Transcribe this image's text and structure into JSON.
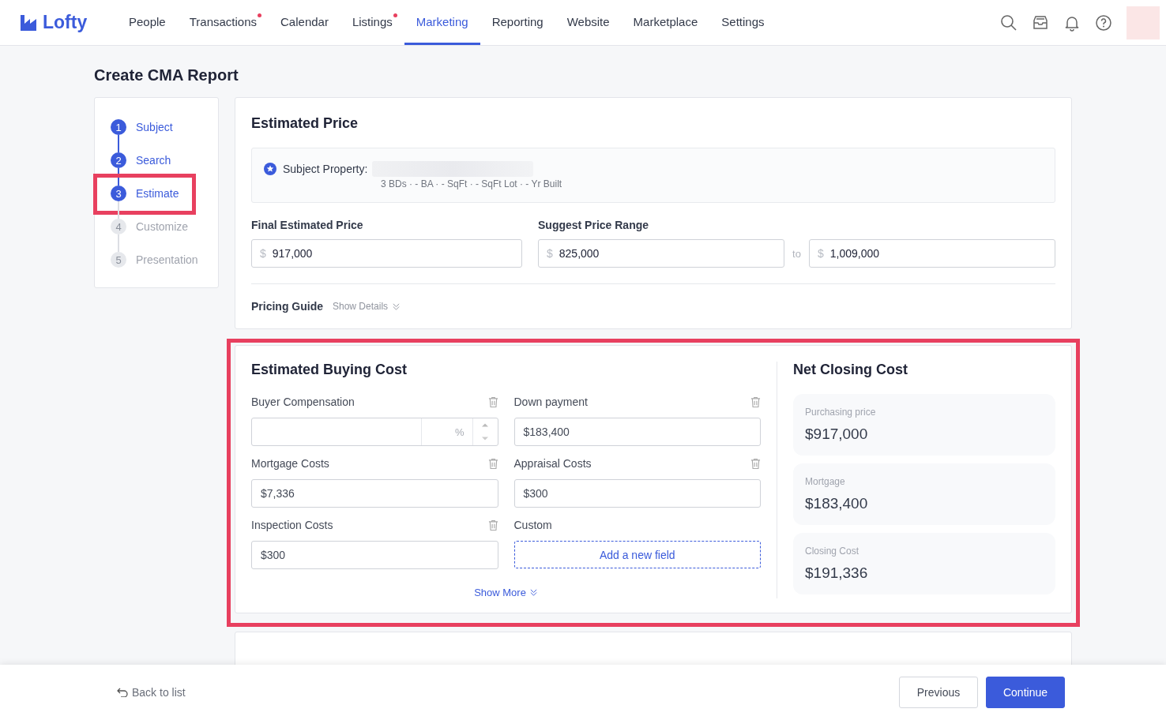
{
  "brand": {
    "name": "Lofty"
  },
  "nav": [
    {
      "label": "People",
      "selected": false,
      "dot": false
    },
    {
      "label": "Transactions",
      "selected": false,
      "dot": true
    },
    {
      "label": "Calendar",
      "selected": false,
      "dot": false
    },
    {
      "label": "Listings",
      "selected": false,
      "dot": true
    },
    {
      "label": "Marketing",
      "selected": true,
      "dot": false
    },
    {
      "label": "Reporting",
      "selected": false,
      "dot": false
    },
    {
      "label": "Website",
      "selected": false,
      "dot": false
    },
    {
      "label": "Marketplace",
      "selected": false,
      "dot": false
    },
    {
      "label": "Settings",
      "selected": false,
      "dot": false
    }
  ],
  "page_title": "Create CMA Report",
  "steps": [
    {
      "number": "1",
      "label": "Subject",
      "disabled": false,
      "highlighted": false
    },
    {
      "number": "2",
      "label": "Search",
      "disabled": false,
      "highlighted": false
    },
    {
      "number": "3",
      "label": "Estimate",
      "disabled": false,
      "highlighted": true
    },
    {
      "number": "4",
      "label": "Customize",
      "disabled": true,
      "highlighted": false
    },
    {
      "number": "5",
      "label": "Presentation",
      "disabled": true,
      "highlighted": false
    }
  ],
  "estimated_price": {
    "title": "Estimated Price",
    "subject_property": {
      "label": "Subject Property:",
      "details": "3 BDs · - BA · - SqFt · - SqFt Lot · - Yr Built"
    },
    "final_price": {
      "label": "Final Estimated Price",
      "prefix": "$",
      "value": "917,000"
    },
    "range": {
      "label": "Suggest Price Range",
      "low": {
        "prefix": "$",
        "value": "825,000"
      },
      "separator": "to",
      "high": {
        "prefix": "$",
        "value": "1,009,000"
      }
    },
    "pricing_guide": {
      "label": "Pricing Guide",
      "link": "Show Details"
    }
  },
  "buying_cost": {
    "title": "Estimated Buying Cost",
    "highlighted": true,
    "fields": [
      {
        "kind": "percent",
        "label": "Buyer Compensation",
        "unit": "%",
        "deletable": true
      },
      {
        "kind": "money",
        "label": "Down payment",
        "value": "$183,400",
        "deletable": true
      },
      {
        "kind": "money",
        "label": "Mortgage Costs",
        "value": "$7,336",
        "deletable": true
      },
      {
        "kind": "money",
        "label": "Appraisal Costs",
        "value": "$300",
        "deletable": true
      },
      {
        "kind": "money",
        "label": "Inspection Costs",
        "value": "$300",
        "deletable": true
      },
      {
        "kind": "add",
        "label": "Custom",
        "button": "Add a new field",
        "deletable": false
      }
    ],
    "show_more": "Show More"
  },
  "net_closing": {
    "title": "Net Closing Cost",
    "items": [
      {
        "label": "Purchasing price",
        "value": "$917,000"
      },
      {
        "label": "Mortgage",
        "value": "$183,400"
      },
      {
        "label": "Closing Cost",
        "value": "$191,336"
      }
    ]
  },
  "footer": {
    "back": "Back to list",
    "previous": "Previous",
    "continue": "Continue"
  }
}
